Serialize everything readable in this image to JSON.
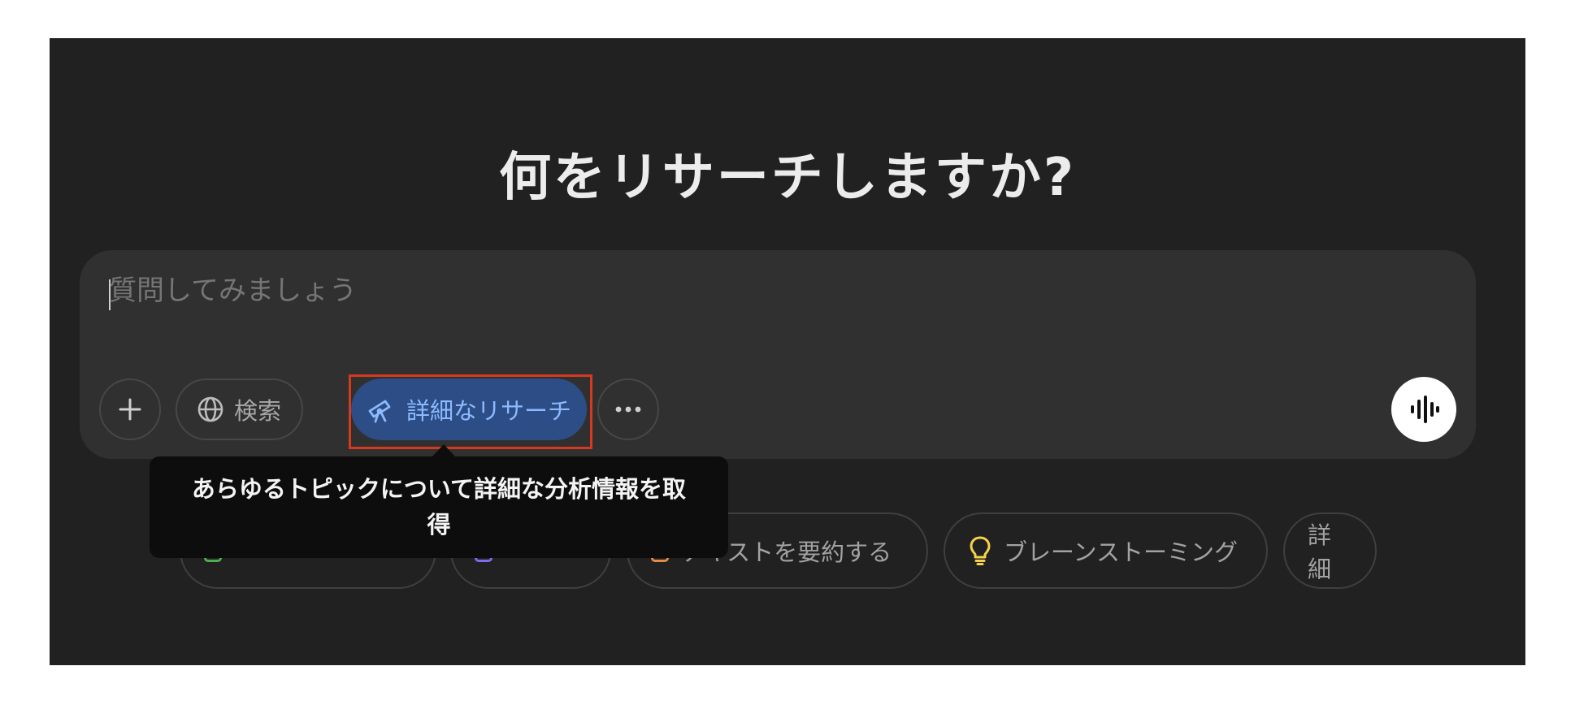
{
  "heading": "何をリサーチしますか?",
  "composer": {
    "placeholder": "質問してみましょう",
    "search_label": "検索",
    "research_label": "詳細なリサーチ"
  },
  "tooltip": {
    "line1": "あらゆるトピックについて詳細な分析情報を取",
    "line2": "得"
  },
  "suggestions": {
    "summarize_label": "テキストを要約する",
    "brainstorm_label": "ブレーンストーミング",
    "more_label": "詳細"
  },
  "colors": {
    "background": "#212121",
    "composer": "#303030",
    "research_button": "#2c4d85",
    "research_text": "#8cbaff",
    "highlight": "#d7391f",
    "chip_green": "#4caf50",
    "chip_purple": "#7b6cf0",
    "chip_orange": "#e8894a",
    "bulb_yellow": "#f5d24b"
  },
  "icons": {
    "add": "plus-icon",
    "search": "globe-icon",
    "research": "telescope-icon",
    "more": "ellipsis-icon",
    "voice": "voice-waveform-icon",
    "brainstorm": "lightbulb-icon"
  }
}
